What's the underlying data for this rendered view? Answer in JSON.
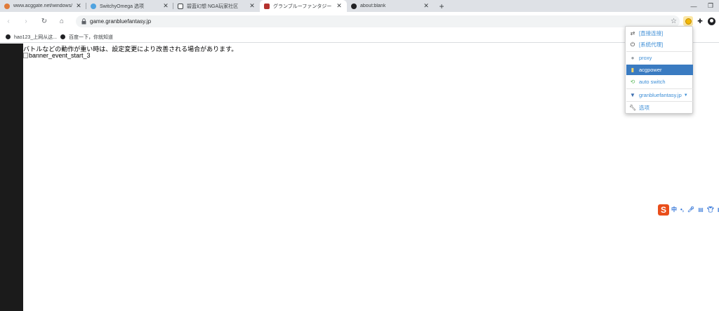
{
  "tabs": [
    {
      "title": "www.acggate.net/windows/",
      "color": "#e07b3a"
    },
    {
      "title": "SwitchyOmega 选项",
      "color": "#4fa3e0"
    },
    {
      "title": "碧蓝幻想 NGA玩家社区",
      "color": "#3c4043"
    },
    {
      "title": "グランブルーファンタジー",
      "color": "#b5322e",
      "active": true
    },
    {
      "title": "about:blank",
      "color": "#202124"
    }
  ],
  "toolbar": {
    "url": "game.granbluefantasy.jp",
    "back_icon": "back-arrow-icon",
    "forward_icon": "forward-arrow-icon",
    "reload_icon": "reload-icon",
    "home_icon": "home-icon"
  },
  "bookmarks": [
    {
      "label": "hao123_上网从这..."
    },
    {
      "label": "百度一下，你就知道"
    }
  ],
  "page": {
    "notice": "バトルなどの動作が重い時は、設定変更により改善される場合があります。",
    "broken_image_alt": "banner_event_start_3"
  },
  "popup": {
    "items": [
      {
        "label": "[直接连接]",
        "icon": "arrows-icon"
      },
      {
        "label": "[系统代理]",
        "icon": "power-icon"
      },
      {
        "label": "proxy",
        "icon": "globe-icon"
      },
      {
        "label": "acgpower",
        "icon": "file-icon",
        "active": true
      },
      {
        "label": "auto switch",
        "icon": "switch-icon"
      },
      {
        "label": "granbluefantasy.jp",
        "icon": "filter-icon"
      },
      {
        "label": "选项",
        "icon": "wrench-icon"
      }
    ],
    "accent": "#3a7bc1"
  },
  "ime": {
    "logo": "S",
    "mode": "中"
  }
}
